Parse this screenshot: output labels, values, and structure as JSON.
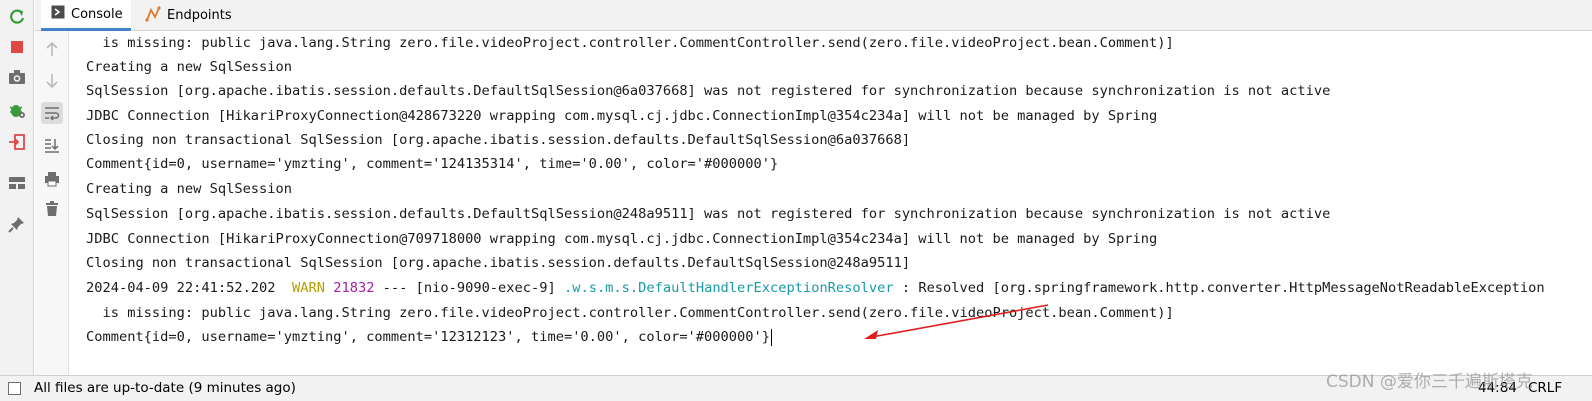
{
  "tabs": [
    {
      "label": "Console",
      "icon": "console-icon",
      "active": true
    },
    {
      "label": "Endpoints",
      "icon": "endpoints-icon",
      "active": false
    }
  ],
  "run_toolbar": [
    "rerun-icon",
    "stop-icon",
    "camera-icon",
    "debug-settings-icon",
    "exit-icon",
    "layout-icon",
    "pin-icon"
  ],
  "console_toolbar": [
    "arrow-up-icon",
    "arrow-down-icon",
    "soft-wrap-icon",
    "scroll-to-end-icon",
    "print-icon",
    "trash-icon"
  ],
  "console": {
    "lines": [
      "  is missing: public java.lang.String zero.file.videoProject.controller.CommentController.send(zero.file.videoProject.bean.Comment)]",
      "Creating a new SqlSession",
      "SqlSession [org.apache.ibatis.session.defaults.DefaultSqlSession@6a037668] was not registered for synchronization because synchronization is not active",
      "JDBC Connection [HikariProxyConnection@428673220 wrapping com.mysql.cj.jdbc.ConnectionImpl@354c234a] will not be managed by Spring",
      "Closing non transactional SqlSession [org.apache.ibatis.session.defaults.DefaultSqlSession@6a037668]",
      "Comment{id=0, username='ymzting', comment='124135314', time='0.00', color='#000000'}",
      "Creating a new SqlSession",
      "SqlSession [org.apache.ibatis.session.defaults.DefaultSqlSession@248a9511] was not registered for synchronization because synchronization is not active",
      "JDBC Connection [HikariProxyConnection@709718000 wrapping com.mysql.cj.jdbc.ConnectionImpl@354c234a] will not be managed by Spring",
      "Closing non transactional SqlSession [org.apache.ibatis.session.defaults.DefaultSqlSession@248a9511]"
    ],
    "log_line": {
      "timestamp": "2024-04-09 22:41:52.202  ",
      "level": "WARN",
      "pid": "21832",
      "sep": " --- [nio-9090-exec-9] ",
      "logger": ".w.s.m.s.DefaultHandlerExceptionResolver",
      "message": " : Resolved [org.springframework.http.converter.HttpMessageNotReadableException"
    },
    "after_lines": [
      "  is missing: public java.lang.String zero.file.videoProject.controller.CommentController.send(zero.file.videoProject.bean.Comment)]",
      "Comment{id=0, username='ymzting', comment='12312123', time='0.00', color='#000000'}"
    ]
  },
  "status": {
    "message": "All files are up-to-date (9 minutes ago)",
    "position": "44:84",
    "line_ending": "CRLF"
  },
  "watermark": "CSDN @爱你三千遍斯塔克",
  "colors": {
    "warn": "#b4a000",
    "pid": "#a61da6",
    "logger": "#1a9aa8",
    "annotation_arrow": "#e02020",
    "tab_underline": "#4083c9"
  }
}
